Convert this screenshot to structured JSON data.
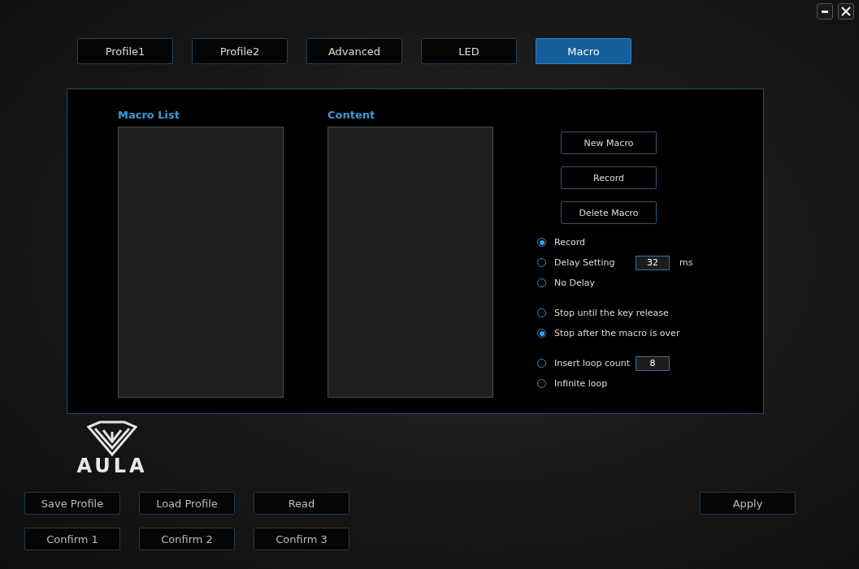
{
  "window_controls": [
    {
      "kind": "minimize"
    },
    {
      "kind": "close"
    }
  ],
  "tabs": [
    {
      "label": "Profile1",
      "selected": false
    },
    {
      "label": "Profile2",
      "selected": false
    },
    {
      "label": "Advanced",
      "selected": false
    },
    {
      "label": "LED",
      "selected": false
    },
    {
      "label": "Macro",
      "selected": true
    }
  ],
  "macro_list": {
    "title": "Macro List"
  },
  "content": {
    "title": "Content"
  },
  "actions": [
    "New Macro",
    "Record",
    "Delete Macro"
  ],
  "option_groups": [
    [
      {
        "label": "Record",
        "selected": true
      },
      {
        "label": "Delay Setting",
        "selected": false,
        "value": "32",
        "unit": "ms"
      },
      {
        "label": "No Delay",
        "selected": false
      }
    ],
    [
      {
        "label": "Stop until the key release",
        "selected": false
      },
      {
        "label": "Stop after the macro is over",
        "selected": true
      }
    ],
    [
      {
        "label": "Insert loop count",
        "selected": false,
        "value": "8"
      },
      {
        "label": "Infinite loop",
        "selected": false
      }
    ]
  ],
  "logo": {
    "text": "AULA"
  },
  "profile_buttons": [
    [
      "Save Profile",
      "Load Profile",
      "Read"
    ],
    [
      "Confirm 1",
      "Confirm 2",
      "Confirm 3"
    ]
  ],
  "apply_button": "Apply"
}
